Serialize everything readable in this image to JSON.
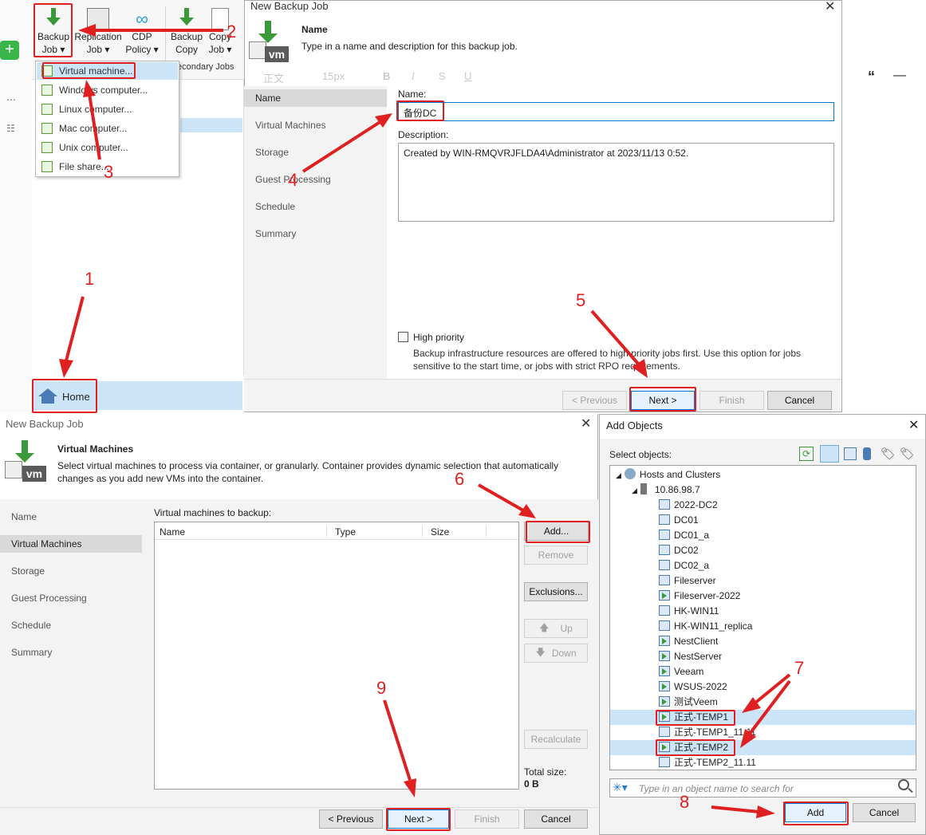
{
  "ribbon": {
    "backup_job": "Backup\nJob ▾",
    "replication_job": "Replication\nJob ▾",
    "cdp_policy": "CDP\nPolicy ▾",
    "backup_copy": "Backup\nCopy",
    "copy_job": "Copy\nJob ▾",
    "secondary_jobs": "econdary Jobs"
  },
  "context_menu": [
    "Virtual machine...",
    "Windows computer...",
    "Linux computer...",
    "Mac computer...",
    "Unix computer...",
    "File share..."
  ],
  "home_button": "Home",
  "dialog1": {
    "title": "New Backup Job",
    "header_title": "Name",
    "header_desc": "Type in a name and description for this backup job.",
    "nav": [
      "Name",
      "Virtual Machines",
      "Storage",
      "Guest Processing",
      "Schedule",
      "Summary"
    ],
    "name_label": "Name:",
    "name_value": "备份DC",
    "desc_label": "Description:",
    "desc_value": "Created by WIN-RMQVRJFLDA4\\Administrator at 2023/11/13 0:52.",
    "high_priority_label": "High priority",
    "high_priority_desc": "Backup infrastructure resources are offered to high priority jobs first. Use this option for jobs sensitive to the start time, or jobs with strict RPO requirements.",
    "btn_previous": "< Previous",
    "btn_next": "Next >",
    "btn_finish": "Finish",
    "btn_cancel": "Cancel"
  },
  "editor_toolbar": {
    "font": "正文",
    "size": "15px"
  },
  "dialog2": {
    "title": "New Backup Job",
    "header_title": "Virtual Machines",
    "header_desc": "Select virtual machines to process via container, or granularly. Container provides dynamic selection that automatically changes as you add new VMs into the container.",
    "nav": [
      "Name",
      "Virtual Machines",
      "Storage",
      "Guest Processing",
      "Schedule",
      "Summary"
    ],
    "list_label": "Virtual machines to backup:",
    "columns": [
      "Name",
      "Type",
      "Size"
    ],
    "btn_add": "Add...",
    "btn_remove": "Remove",
    "btn_exclusions": "Exclusions...",
    "btn_up": "Up",
    "btn_down": "Down",
    "btn_recalculate": "Recalculate",
    "total_size_label": "Total size:",
    "total_size_value": "0 B",
    "btn_previous": "< Previous",
    "btn_next": "Next >",
    "btn_finish": "Finish",
    "btn_cancel": "Cancel"
  },
  "add_objects": {
    "title": "Add Objects",
    "select_label": "Select objects:",
    "root": "Hosts and Clusters",
    "host": "10.86.98.7",
    "vms": [
      "2022-DC2",
      "DC01",
      "DC01_a",
      "DC02",
      "DC02_a",
      "Fileserver",
      "Fileserver-2022",
      "HK-WIN11",
      "HK-WIN11_replica",
      "NestClient",
      "NestServer",
      "Veeam",
      "WSUS-2022",
      "测试Veem",
      "正式-TEMP1",
      "正式-TEMP1_11.11",
      "正式-TEMP2",
      "正式-TEMP2_11.11"
    ],
    "search_placeholder": "Type in an object name to search for",
    "btn_add": "Add",
    "btn_cancel": "Cancel"
  },
  "annotations": [
    "1",
    "2",
    "3",
    "4",
    "5",
    "6",
    "7",
    "8",
    "9"
  ],
  "colors": {
    "accent_red": "#e02020",
    "veeam_green": "#3a9a3a",
    "selection_blue": "#cce4f7"
  }
}
